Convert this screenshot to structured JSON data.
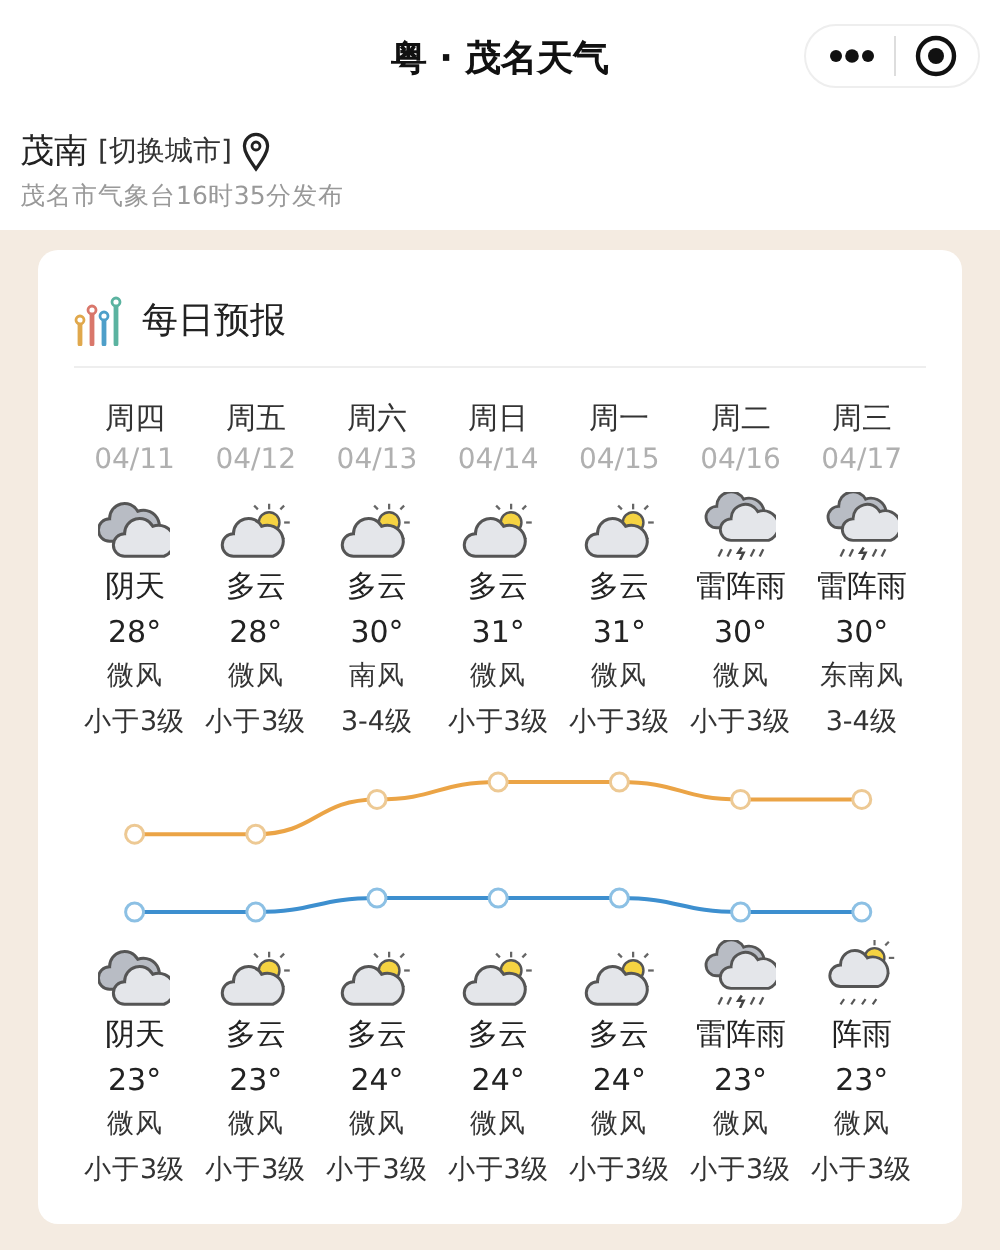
{
  "title": "粤 · 茂名天气",
  "location": {
    "city": "茂南",
    "switch": "[切换城市]"
  },
  "publish": "茂名市气象台16时35分发布",
  "forecast": {
    "title": "每日预报",
    "days": [
      {
        "weekday": "周四",
        "date": "04/11",
        "day": {
          "kind": "overcast",
          "weather": "阴天",
          "temp": "28°",
          "wind": "微风",
          "wind_force": "小于3级"
        },
        "night": {
          "kind": "overcast",
          "weather": "阴天",
          "temp": "23°",
          "wind": "微风",
          "wind_force": "小于3级"
        }
      },
      {
        "weekday": "周五",
        "date": "04/12",
        "day": {
          "kind": "partly-cloudy",
          "weather": "多云",
          "temp": "28°",
          "wind": "微风",
          "wind_force": "小于3级"
        },
        "night": {
          "kind": "partly-cloudy",
          "weather": "多云",
          "temp": "23°",
          "wind": "微风",
          "wind_force": "小于3级"
        }
      },
      {
        "weekday": "周六",
        "date": "04/13",
        "day": {
          "kind": "partly-cloudy",
          "weather": "多云",
          "temp": "30°",
          "wind": "南风",
          "wind_force": "3-4级"
        },
        "night": {
          "kind": "partly-cloudy",
          "weather": "多云",
          "temp": "24°",
          "wind": "微风",
          "wind_force": "小于3级"
        }
      },
      {
        "weekday": "周日",
        "date": "04/14",
        "day": {
          "kind": "partly-cloudy",
          "weather": "多云",
          "temp": "31°",
          "wind": "微风",
          "wind_force": "小于3级"
        },
        "night": {
          "kind": "partly-cloudy",
          "weather": "多云",
          "temp": "24°",
          "wind": "微风",
          "wind_force": "小于3级"
        }
      },
      {
        "weekday": "周一",
        "date": "04/15",
        "day": {
          "kind": "partly-cloudy",
          "weather": "多云",
          "temp": "31°",
          "wind": "微风",
          "wind_force": "小于3级"
        },
        "night": {
          "kind": "partly-cloudy",
          "weather": "多云",
          "temp": "24°",
          "wind": "微风",
          "wind_force": "小于3级"
        }
      },
      {
        "weekday": "周二",
        "date": "04/16",
        "day": {
          "kind": "thunderstorm",
          "weather": "雷阵雨",
          "temp": "30°",
          "wind": "微风",
          "wind_force": "小于3级"
        },
        "night": {
          "kind": "thunderstorm",
          "weather": "雷阵雨",
          "temp": "23°",
          "wind": "微风",
          "wind_force": "小于3级"
        }
      },
      {
        "weekday": "周三",
        "date": "04/17",
        "day": {
          "kind": "thunderstorm",
          "weather": "雷阵雨",
          "temp": "30°",
          "wind": "东南风",
          "wind_force": "3-4级"
        },
        "night": {
          "kind": "shower",
          "weather": "阵雨",
          "temp": "23°",
          "wind": "微风",
          "wind_force": "小于3级"
        }
      }
    ]
  }
}
